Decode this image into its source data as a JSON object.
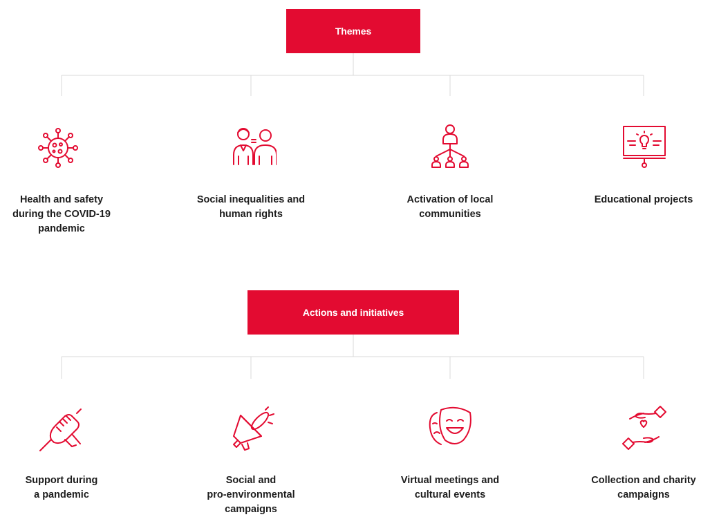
{
  "colors": {
    "accent": "#e30b31",
    "line": "#d9d9d9",
    "text": "#1d1d1d"
  },
  "themes": {
    "title": "Themes",
    "items": [
      {
        "icon": "virus-icon",
        "lines": [
          "Health and safety",
          "during the COVID-19",
          "pandemic"
        ]
      },
      {
        "icon": "people-talking-icon",
        "lines": [
          "Social inequalities and",
          "human rights"
        ]
      },
      {
        "icon": "community-network-icon",
        "lines": [
          "Activation of local",
          "communities"
        ]
      },
      {
        "icon": "presentation-lightbulb-icon",
        "lines": [
          "Educational projects"
        ]
      }
    ]
  },
  "actions": {
    "title": "Actions and initiatives",
    "items": [
      {
        "icon": "handshake-icon",
        "lines": [
          "Support during",
          "a pandemic"
        ]
      },
      {
        "icon": "megaphone-icon",
        "lines": [
          "Social and",
          "pro-environmental",
          "campaigns"
        ]
      },
      {
        "icon": "theater-masks-icon",
        "lines": [
          "Virtual meetings and",
          "cultural events"
        ]
      },
      {
        "icon": "charity-hands-icon",
        "lines": [
          "Collection and charity",
          "campaigns"
        ]
      }
    ]
  }
}
